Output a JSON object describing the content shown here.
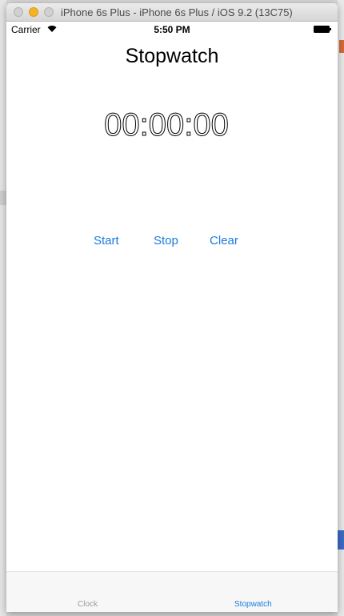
{
  "window": {
    "title": "iPhone 6s Plus - iPhone 6s Plus / iOS 9.2 (13C75)"
  },
  "status_bar": {
    "carrier": "Carrier",
    "time": "5:50 PM",
    "icons": [
      "wifi-icon",
      "battery-icon"
    ]
  },
  "nav": {
    "title": "Stopwatch"
  },
  "timer": {
    "display": "00:00:00"
  },
  "controls": {
    "start_label": "Start",
    "stop_label": "Stop",
    "clear_label": "Clear"
  },
  "tabbar": {
    "tabs": [
      {
        "label": "Clock",
        "selected": false
      },
      {
        "label": "Stopwatch",
        "selected": true
      }
    ]
  },
  "colors": {
    "accent": "#1a7be0",
    "inactive_tab": "#9b9b9b",
    "minimize_button": "#f5b324"
  }
}
